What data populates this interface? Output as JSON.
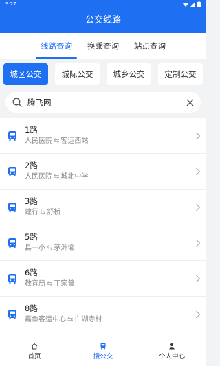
{
  "status": {
    "time": "9:27"
  },
  "header": {
    "title": "公交线路"
  },
  "tabs": [
    {
      "label": "线路查询",
      "active": true
    },
    {
      "label": "换乘查询",
      "active": false
    },
    {
      "label": "站点查询",
      "active": false
    }
  ],
  "categories": [
    {
      "label": "城区公交",
      "active": true
    },
    {
      "label": "城际公交",
      "active": false
    },
    {
      "label": "城乡公交",
      "active": false
    },
    {
      "label": "定制公交",
      "active": false
    }
  ],
  "search": {
    "value": "腾飞网"
  },
  "routes": [
    {
      "name": "1路",
      "from": "人民医院",
      "to": "客运西站"
    },
    {
      "name": "2路",
      "from": "人民医院",
      "to": "城北中学"
    },
    {
      "name": "3路",
      "from": "建行",
      "to": "舒桥"
    },
    {
      "name": "5路",
      "from": "县一小",
      "to": "茅洲垴"
    },
    {
      "name": "6路",
      "from": "教育局",
      "to": "丁家曾"
    },
    {
      "name": "8路",
      "from": "嘉鱼客运中心",
      "to": "白湖寺村"
    }
  ],
  "bottom_nav": [
    {
      "label": "首页",
      "icon": "home-icon",
      "active": false
    },
    {
      "label": "搜公交",
      "icon": "bus-icon",
      "active": true
    },
    {
      "label": "个人中心",
      "icon": "user-icon",
      "active": false
    }
  ],
  "colors": {
    "primary": "#1f6ff2"
  }
}
